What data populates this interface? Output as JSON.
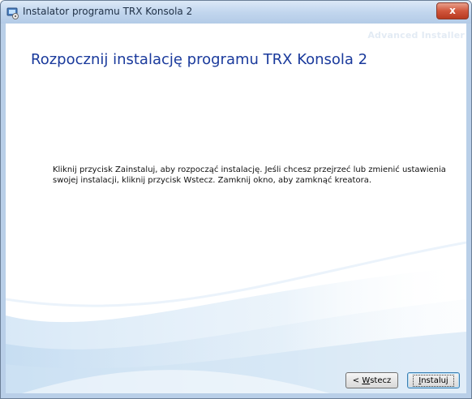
{
  "window": {
    "title": "Instalator programu TRX Konsola 2",
    "close_label": "x"
  },
  "header": {
    "brand": "Advanced Installer",
    "title": "Rozpocznij instalację programu TRX Konsola 2"
  },
  "content": {
    "description": "Kliknij przycisk Zainstaluj, aby rozpocząć instalację. Jeśli chcesz przejrzeć lub zmienić ustawienia swojej instalacji, kliknij przycisk Wstecz. Zamknij okno, aby zamknąć kreatora."
  },
  "buttons": {
    "back_prefix": "< ",
    "back_mnemonic": "W",
    "back_rest": "stecz",
    "install_mnemonic": "I",
    "install_rest": "nstaluj"
  },
  "colors": {
    "title_blue": "#1a3a9c",
    "swoosh_blue": "#cfe3f4"
  },
  "icons": {
    "app": "installer-icon",
    "close": "close-icon"
  }
}
